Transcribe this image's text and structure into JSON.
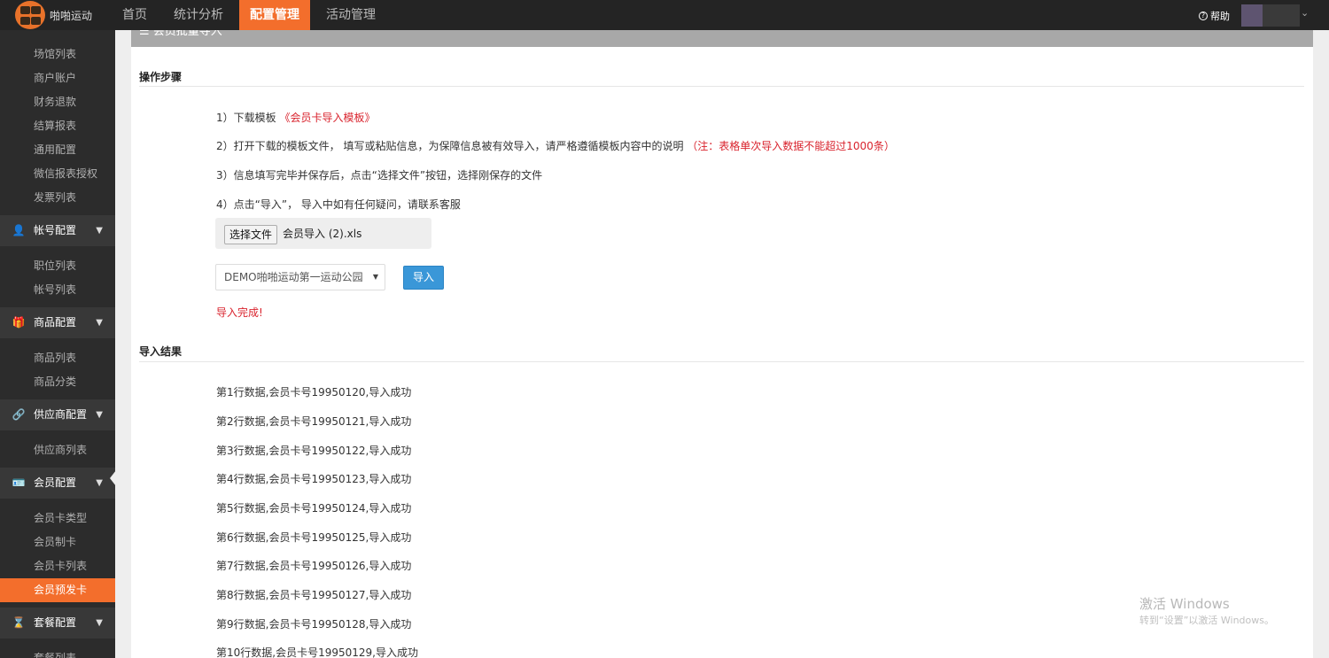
{
  "topbar": {
    "brand": "啪啪运动",
    "tabs": [
      {
        "label": "首页",
        "active": false
      },
      {
        "label": "统计分析",
        "active": false
      },
      {
        "label": "配置管理",
        "active": true
      },
      {
        "label": "活动管理",
        "active": false
      }
    ],
    "help_label": "帮助",
    "accent_color": "#f36e2c"
  },
  "sidebar": {
    "group0": [
      "场馆列表",
      "商户账户",
      "财务退款",
      "结算报表",
      "通用配置",
      "微信报表授权",
      "发票列表"
    ],
    "account_head": "帐号配置",
    "account_items": [
      "职位列表",
      "帐号列表"
    ],
    "goods_head": "商品配置",
    "goods_items": [
      "商品列表",
      "商品分类"
    ],
    "supplier_head": "供应商配置",
    "supplier_items": [
      "供应商列表"
    ],
    "member_head": "会员配置",
    "member_items": [
      "会员卡类型",
      "会员制卡",
      "会员卡列表"
    ],
    "member_active_item": "会员预发卡",
    "package_head": "套餐配置",
    "package_items": [
      "套餐列表"
    ]
  },
  "panel": {
    "header": "☰ 会员批量导入",
    "steps_title": "操作步骤",
    "step1_prefix": "1）下载模板 ",
    "step1_link": "《会员卡导入模板》",
    "step2_text": "2）打开下载的模板文件， 填写或粘贴信息，为保障信息被有效导入，请严格遵循模板内容中的说明 ",
    "step2_note": "（注：表格单次导入数据不能超过1000条）",
    "step3_text": "3）信息填写完毕并保存后，点击“选择文件”按钮，选择刚保存的文件",
    "step4_text": "4）点击“导入”， 导入中如有任何疑问，请联系客服",
    "file_button": "选择文件",
    "file_name": "会员导入 (2).xls",
    "venue_selected": "DEMO啪啪运动第一运动公园",
    "import_button": "导入",
    "done_text": "导入完成!",
    "results_title": "导入结果",
    "results": [
      "第1行数据,会员卡号19950120,导入成功",
      "第2行数据,会员卡号19950121,导入成功",
      "第3行数据,会员卡号19950122,导入成功",
      "第4行数据,会员卡号19950123,导入成功",
      "第5行数据,会员卡号19950124,导入成功",
      "第6行数据,会员卡号19950125,导入成功",
      "第7行数据,会员卡号19950126,导入成功",
      "第8行数据,会员卡号19950127,导入成功",
      "第9行数据,会员卡号19950128,导入成功",
      "第10行数据,会员卡号19950129,导入成功"
    ]
  },
  "watermark": {
    "line1": "激活 Windows",
    "line2": "转到“设置”以激活 Windows。"
  }
}
